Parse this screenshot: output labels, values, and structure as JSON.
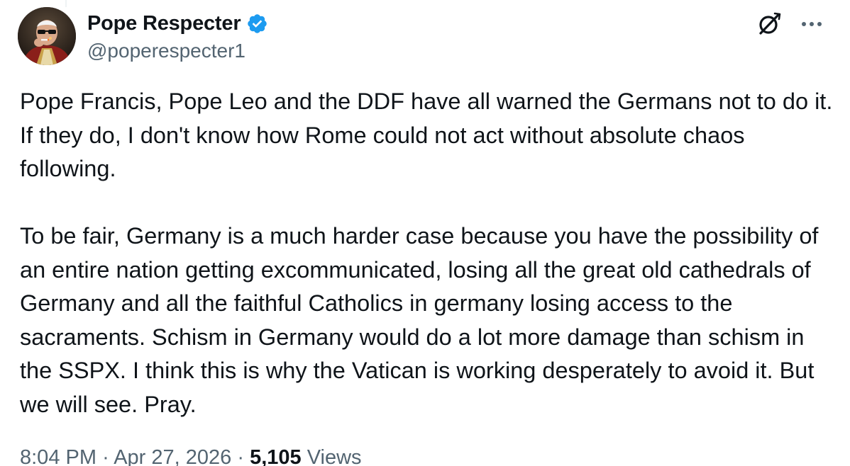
{
  "author": {
    "display_name": "Pope Respecter",
    "handle": "@poperespecter1",
    "verified": true
  },
  "actions": {
    "grok_icon": "grok-icon",
    "more_icon": "more-icon"
  },
  "tweet": {
    "paragraphs": [
      "Pope Francis, Pope Leo and the DDF have all warned the Germans not to do it. If they do, I don't know how Rome could not act without absolute chaos following.",
      "To be fair, Germany is a much harder case because you have the possibility of an entire nation getting excommunicated, losing all the great old cathedrals of Germany and all the faithful Catholics in germany losing access to the sacraments. Schism in Germany would do a lot more damage than schism in the SSPX. I think this is why the Vatican is working desperately to avoid it. But we will see. Pray."
    ]
  },
  "meta": {
    "time": "8:04 PM",
    "separator": "·",
    "date": "Apr 27, 2026",
    "views_count": "5,105",
    "views_label": "Views"
  },
  "colors": {
    "text": "#0f1419",
    "secondary": "#536471",
    "verified_blue": "#1d9bf0"
  }
}
